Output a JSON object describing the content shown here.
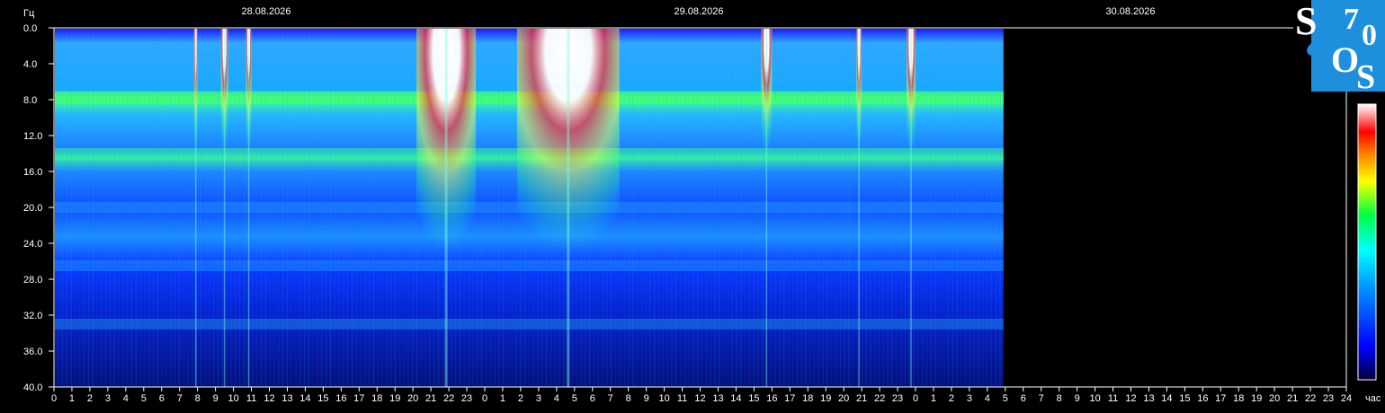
{
  "chart_data": {
    "type": "heatmap",
    "title": "",
    "ylabel": "Гц",
    "xlabel": "час",
    "dates": [
      "28.08.2026",
      "29.08.2026",
      "30.08.2026"
    ],
    "y_ticks": [
      "0.0",
      "4.0",
      "8.0",
      "12.0",
      "16.0",
      "20.0",
      "24.0",
      "28.0",
      "32.0",
      "36.0",
      "40.0"
    ],
    "ylim": [
      0,
      40
    ],
    "x_ticks": [
      "0",
      "1",
      "2",
      "3",
      "4",
      "5",
      "6",
      "7",
      "8",
      "9",
      "10",
      "11",
      "12",
      "13",
      "14",
      "15",
      "16",
      "17",
      "18",
      "19",
      "20",
      "21",
      "22",
      "23",
      "0",
      "1",
      "2",
      "3",
      "4",
      "5",
      "6",
      "7",
      "8",
      "9",
      "10",
      "11",
      "12",
      "13",
      "14",
      "15",
      "16",
      "17",
      "18",
      "19",
      "20",
      "21",
      "22",
      "23",
      "0",
      "1",
      "2",
      "3",
      "4",
      "5",
      "6",
      "7",
      "8",
      "9",
      "10",
      "11",
      "12",
      "13",
      "14",
      "15",
      "16",
      "17",
      "18",
      "19",
      "20",
      "21",
      "22",
      "23",
      "24"
    ],
    "xlim_hours": [
      0,
      72
    ],
    "data_end_hour": 52.9,
    "resonance_bands_hz": [
      7.8,
      14.1,
      20.0,
      26.5,
      33.0
    ],
    "intense_periods_hours": [
      [
        7.8,
        8.0
      ],
      [
        9.3,
        9.7
      ],
      [
        10.7,
        11.0
      ],
      [
        20.2,
        23.5
      ],
      [
        25.8,
        31.5
      ],
      [
        39.4,
        40.0
      ],
      [
        44.7,
        45.0
      ],
      [
        47.5,
        48.0
      ]
    ],
    "colorscale": [
      "#00003a",
      "#0000ff",
      "#00a0ff",
      "#00ffff",
      "#00ff40",
      "#ffff00",
      "#ff8000",
      "#ff0000",
      "#ffffff"
    ]
  },
  "logo": {
    "letters": [
      "S",
      "7",
      "0",
      "O",
      "S"
    ],
    "color": "#1e8fdc"
  }
}
